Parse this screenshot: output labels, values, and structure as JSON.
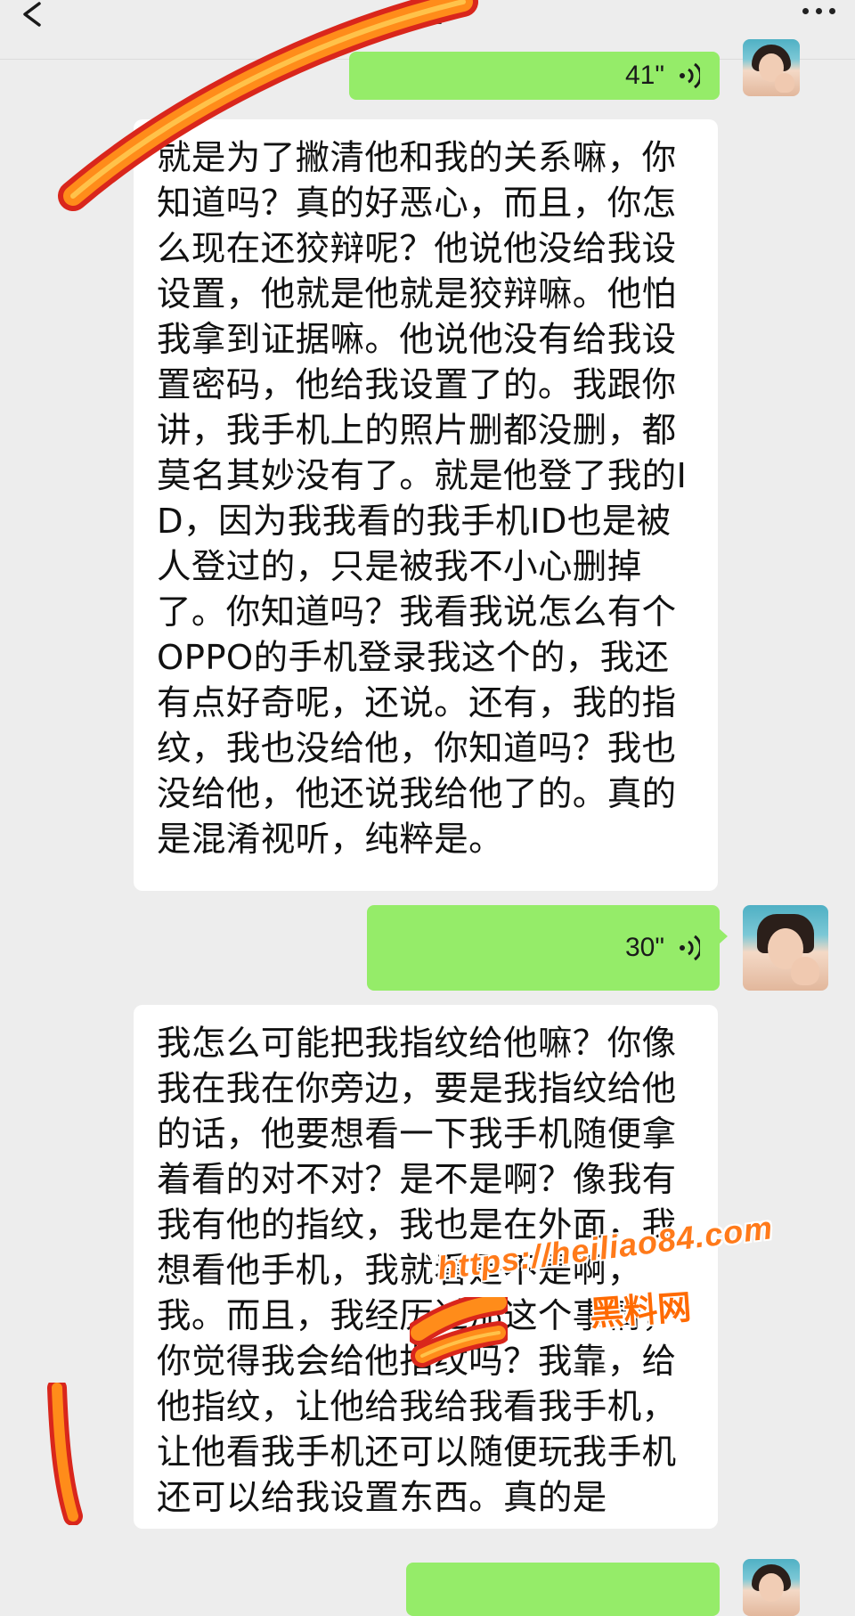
{
  "header": {
    "back_icon": "chevron-left-icon",
    "title": "姐",
    "more_icon": "ellipsis-icon"
  },
  "messages": [
    {
      "type": "voice",
      "side": "right",
      "duration": "41\"",
      "icon": "voice-wave-icon"
    },
    {
      "type": "text",
      "side": "left",
      "text": "就是为了撇清他和我的关系嘛，你知道吗？真的好恶心，而且，你怎么现在还狡辩呢？他说他没给我设设置，他就是他就是狡辩嘛。他怕我拿到证据嘛。他说他没有给我设置密码，他给我设置了的。我跟你讲，我手机上的照片删都没删，都莫名其妙没有了。就是他登了我的ID，因为我我看的我手机ID也是被人登过的，只是被我不小心删掉了。你知道吗？我看我说怎么有个OPPO的手机登录我这个的，我还有点好奇呢，还说。还有，我的指纹，我也没给他，你知道吗？我也没给他，他还说我给他了的。真的是混淆视听，纯粹是。"
    },
    {
      "type": "voice",
      "side": "right",
      "duration": "30\"",
      "icon": "voice-wave-icon"
    },
    {
      "type": "text",
      "side": "left",
      "text": "我怎么可能把我指纹给他嘛？你像我在我在你旁边，要是我指纹给他的话，他要想看一下我手机随便拿着看的对不对？是不是啊？像我有我有他的指纹，我也是在外面，我想看他手机，我就看是不是啊，我。而且，我经历过那这个事情，你觉得我会给他指纹吗？我靠，给他指纹，让他给我给我看我手机，让他看我手机还可以随便玩我手机还可以给我设置东西。真的是"
    }
  ],
  "watermark": {
    "url": "https://heiliao84.com",
    "name": "黑料网"
  },
  "colors": {
    "background": "#ededed",
    "self_bubble": "#95ec69",
    "other_bubble": "#ffffff",
    "stripe_red": "#d9261c",
    "stripe_orange": "#ff8c1a",
    "stripe_yellow": "#ffc24a"
  }
}
